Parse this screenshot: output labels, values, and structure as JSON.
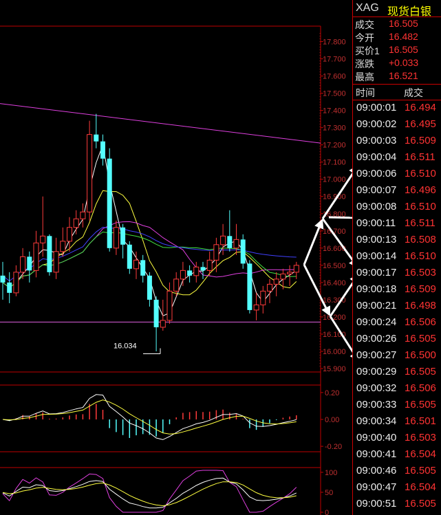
{
  "header": {
    "symbol": "XAG",
    "name": "现货白银"
  },
  "quote": [
    {
      "label": "成交",
      "value": "16.505"
    },
    {
      "label": "今开",
      "value": "16.482"
    },
    {
      "label": "买价1",
      "value": "16.505"
    },
    {
      "label": "涨跌",
      "value": "+0.033"
    },
    {
      "label": "最高",
      "value": "16.521"
    }
  ],
  "ticks_header": {
    "time": "时间",
    "price": "成交"
  },
  "ticks": [
    {
      "time": "09:00:01",
      "price": "16.494"
    },
    {
      "time": "09:00:02",
      "price": "16.495"
    },
    {
      "time": "09:00:03",
      "price": "16.509"
    },
    {
      "time": "09:00:04",
      "price": "16.511"
    },
    {
      "time": "09:00:06",
      "price": "16.510"
    },
    {
      "time": "09:00:07",
      "price": "16.496"
    },
    {
      "time": "09:00:08",
      "price": "16.510"
    },
    {
      "time": "09:00:11",
      "price": "16.511"
    },
    {
      "time": "09:00:13",
      "price": "16.508"
    },
    {
      "time": "09:00:14",
      "price": "16.510"
    },
    {
      "time": "09:00:17",
      "price": "16.503"
    },
    {
      "time": "09:00:18",
      "price": "16.509"
    },
    {
      "time": "09:00:21",
      "price": "16.498"
    },
    {
      "time": "09:00:24",
      "price": "16.506"
    },
    {
      "time": "09:00:26",
      "price": "16.505"
    },
    {
      "time": "09:00:27",
      "price": "16.500"
    },
    {
      "time": "09:00:29",
      "price": "16.505"
    },
    {
      "time": "09:00:32",
      "price": "16.506"
    },
    {
      "time": "09:00:33",
      "price": "16.505"
    },
    {
      "time": "09:00:34",
      "price": "16.501"
    },
    {
      "time": "09:00:40",
      "price": "16.503"
    },
    {
      "time": "09:00:41",
      "price": "16.504"
    },
    {
      "time": "09:00:46",
      "price": "16.505"
    },
    {
      "time": "09:00:47",
      "price": "16.504"
    },
    {
      "time": "09:00:51",
      "price": "16.505"
    }
  ],
  "chart_data": [
    {
      "type": "candlestick",
      "y_ticks": [
        "17.800",
        "17.700",
        "17.600",
        "17.500",
        "17.400",
        "17.300",
        "17.200",
        "17.100",
        "17.000",
        "16.900",
        "16.800",
        "16.700",
        "16.600",
        "16.500",
        "16.400",
        "16.300",
        "16.200",
        "16.100",
        "16.000",
        "15.900"
      ],
      "ylim": [
        15.9,
        17.85
      ],
      "annotation": {
        "label": "16.034",
        "value": 16.034
      },
      "candles": [
        [
          16.44,
          16.52,
          16.3,
          16.4
        ],
        [
          16.4,
          16.46,
          16.28,
          16.34
        ],
        [
          16.34,
          16.5,
          16.32,
          16.46
        ],
        [
          16.46,
          16.6,
          16.42,
          16.55
        ],
        [
          16.55,
          16.58,
          16.4,
          16.47
        ],
        [
          16.47,
          16.7,
          16.43,
          16.63
        ],
        [
          16.63,
          16.9,
          16.55,
          16.67
        ],
        [
          16.67,
          16.68,
          16.44,
          16.46
        ],
        [
          16.46,
          16.66,
          16.42,
          16.58
        ],
        [
          16.58,
          16.72,
          16.55,
          16.64
        ],
        [
          16.64,
          16.78,
          16.58,
          16.72
        ],
        [
          16.72,
          16.82,
          16.68,
          16.77
        ],
        [
          16.77,
          16.86,
          16.72,
          16.81
        ],
        [
          16.81,
          17.34,
          16.76,
          17.26
        ],
        [
          17.26,
          17.38,
          17.18,
          17.22
        ],
        [
          17.22,
          17.26,
          17.08,
          17.12
        ],
        [
          17.12,
          17.18,
          16.58,
          16.6
        ],
        [
          16.6,
          16.76,
          16.56,
          16.72
        ],
        [
          16.72,
          16.74,
          16.54,
          16.62
        ],
        [
          16.62,
          16.64,
          16.45,
          16.48
        ],
        [
          16.48,
          16.58,
          16.42,
          16.53
        ],
        [
          16.53,
          16.56,
          16.4,
          16.44
        ],
        [
          16.44,
          16.46,
          16.26,
          16.3
        ],
        [
          16.3,
          16.32,
          16.0,
          16.14
        ],
        [
          16.14,
          16.3,
          16.12,
          16.18
        ],
        [
          16.18,
          16.4,
          16.16,
          16.35
        ],
        [
          16.35,
          16.46,
          16.32,
          16.42
        ],
        [
          16.42,
          16.52,
          16.38,
          16.47
        ],
        [
          16.47,
          16.5,
          16.4,
          16.44
        ],
        [
          16.44,
          16.52,
          16.4,
          16.49
        ],
        [
          16.49,
          16.52,
          16.42,
          16.47
        ],
        [
          16.47,
          16.58,
          16.44,
          16.53
        ],
        [
          16.53,
          16.66,
          16.46,
          16.62
        ],
        [
          16.62,
          16.74,
          16.56,
          16.67
        ],
        [
          16.67,
          16.82,
          16.58,
          16.6
        ],
        [
          16.6,
          16.74,
          16.56,
          16.65
        ],
        [
          16.65,
          16.68,
          16.48,
          16.51
        ],
        [
          16.51,
          16.53,
          16.22,
          16.24
        ],
        [
          16.24,
          16.34,
          16.18,
          16.27
        ],
        [
          16.27,
          16.38,
          16.22,
          16.35
        ],
        [
          16.35,
          16.42,
          16.28,
          16.39
        ],
        [
          16.39,
          16.46,
          16.32,
          16.42
        ],
        [
          16.42,
          16.48,
          16.36,
          16.45
        ],
        [
          16.45,
          16.5,
          16.38,
          16.46
        ],
        [
          16.46,
          16.52,
          16.42,
          16.5
        ]
      ]
    },
    {
      "type": "bar",
      "y_ticks": [
        "0.20",
        "0.00",
        "-0.20"
      ],
      "ylim": [
        -0.22,
        0.22
      ]
    },
    {
      "type": "line",
      "y_ticks": [
        "100",
        "50",
        "0"
      ],
      "ylim": [
        0,
        105
      ]
    }
  ]
}
